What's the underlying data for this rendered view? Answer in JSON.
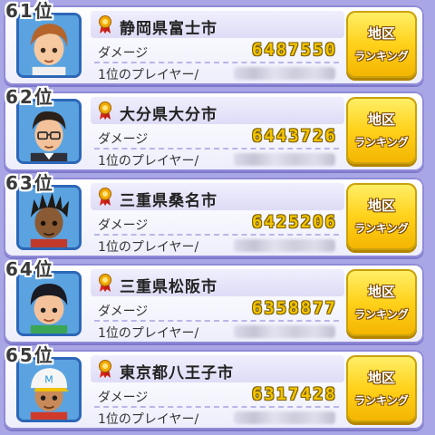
{
  "ranking": {
    "damage_label": "ダメージ",
    "player_label": "1位のプレイヤー/",
    "button_line1": "地区",
    "button_line2": "ランキング",
    "entries": [
      {
        "rank": "61位",
        "city": "静岡県富士市",
        "damage": "6487550",
        "avatar_icon": "boy-brown-hair-avatar-icon"
      },
      {
        "rank": "62位",
        "city": "大分県大分市",
        "damage": "6443726",
        "avatar_icon": "man-glasses-avatar-icon"
      },
      {
        "rank": "63位",
        "city": "三重県桑名市",
        "damage": "6425206",
        "avatar_icon": "spiky-hair-dark-skin-avatar-icon"
      },
      {
        "rank": "64位",
        "city": "三重県松阪市",
        "damage": "6358877",
        "avatar_icon": "boy-black-hair-avatar-icon"
      },
      {
        "rank": "65位",
        "city": "東京都八王子市",
        "damage": "6317428",
        "avatar_icon": "cap-wearing-avatar-icon"
      }
    ]
  },
  "colors": {
    "background": "#a9a6e6",
    "damage_value": "#f2c300",
    "button": "#ffd11a"
  }
}
